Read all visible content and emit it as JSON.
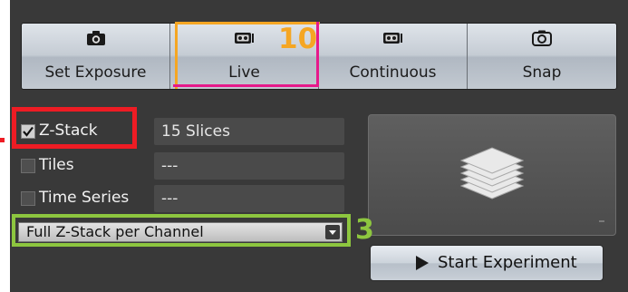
{
  "toolbar": {
    "buttons": [
      {
        "label": "Set Exposure",
        "icon": "camera-icon"
      },
      {
        "label": "Live",
        "icon": "live-camera-icon"
      },
      {
        "label": "Continuous",
        "icon": "continuous-camera-icon"
      },
      {
        "label": "Snap",
        "icon": "snap-camera-icon"
      }
    ]
  },
  "options": {
    "z_stack": {
      "label": "Z-Stack",
      "checked": true,
      "value": "15 Slices"
    },
    "tiles": {
      "label": "Tiles",
      "checked": false,
      "value": "---"
    },
    "time_series": {
      "label": "Time Series",
      "checked": false,
      "value": "---"
    }
  },
  "mode_dropdown": {
    "selected": "Full Z-Stack per Channel"
  },
  "preview": {
    "icon": "z-stack-layers-icon"
  },
  "start_button": {
    "label": "Start Experiment",
    "icon": "play-icon"
  },
  "annotations": {
    "live_number": "10",
    "dropdown_number": "3",
    "colors": {
      "red": "#ee1c24",
      "orange": "#f5a623",
      "magenta": "#e6198b",
      "green": "#8dc63f"
    }
  }
}
